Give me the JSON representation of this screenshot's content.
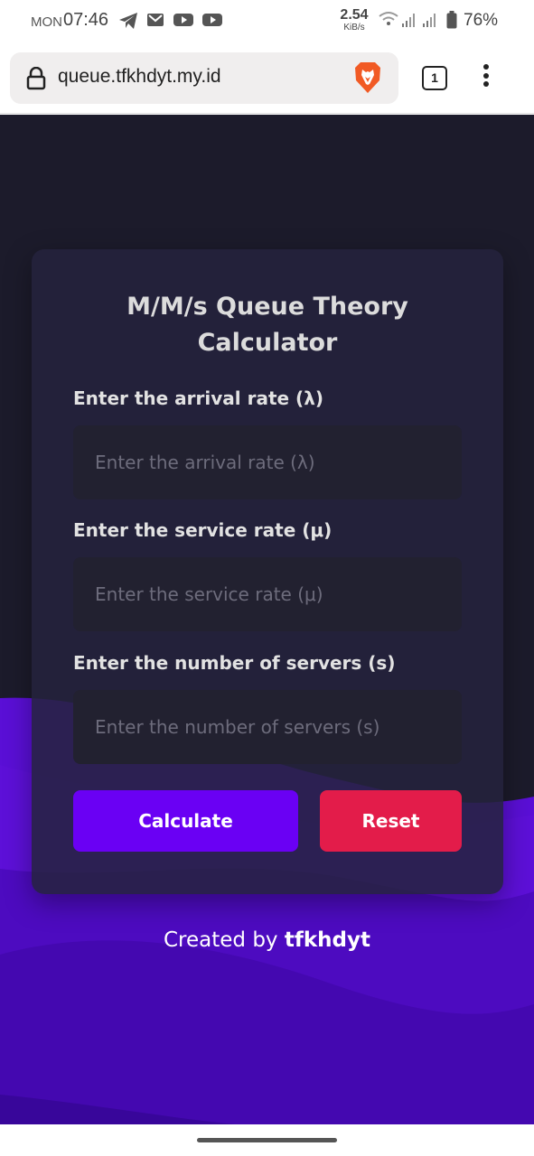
{
  "status_bar": {
    "day": "MON",
    "time": "07:46",
    "speed_value": "2.54",
    "speed_unit": "KiB/s",
    "battery": "76%",
    "icons": [
      "telegram-icon",
      "gmail-icon",
      "youtube-icon",
      "youtube-icon",
      "wifi-icon",
      "signal-icon",
      "signal-icon",
      "battery-icon"
    ]
  },
  "browser": {
    "url": "queue.tfkhdyt.my.id",
    "tab_count": "1",
    "icons": [
      "lock-icon",
      "brave-lion-icon",
      "tabs-icon",
      "more-vert-icon"
    ]
  },
  "card": {
    "title_line1": "M/M/s Queue Theory",
    "title_line2": "Calculator",
    "fields": [
      {
        "label": "Enter the arrival rate (λ)",
        "placeholder": "Enter the arrival rate (λ)",
        "value": ""
      },
      {
        "label": "Enter the service rate (μ)",
        "placeholder": "Enter the service rate (μ)",
        "value": ""
      },
      {
        "label": "Enter the number of servers (s)",
        "placeholder": "Enter the number of servers (s)",
        "value": ""
      }
    ],
    "calculate_label": "Calculate",
    "reset_label": "Reset"
  },
  "footer": {
    "prefix": "Created by",
    "author": "tfkhdyt"
  },
  "colors": {
    "page_bg": "#1c1b2b",
    "card_bg": "#24233c",
    "calculate_button": "#6a00f4",
    "reset_button": "#e31c4a",
    "wave_purple": "#5b0ed6"
  }
}
